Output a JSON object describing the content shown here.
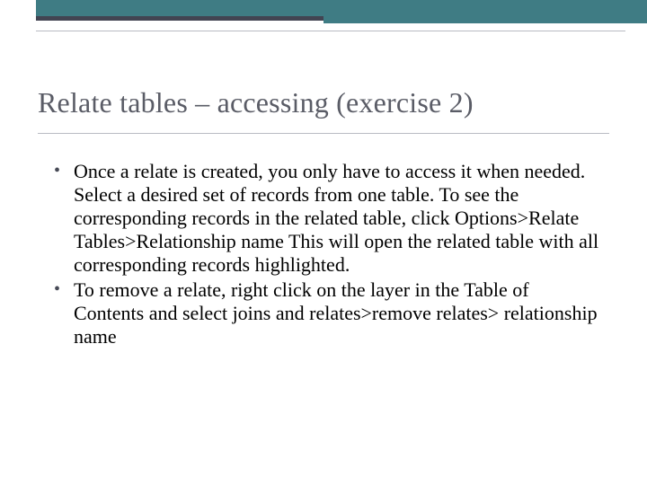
{
  "title": "Relate tables – accessing (exercise 2)",
  "bullets": {
    "b1": "Once a relate is created, you only have to access it when needed.  Select a desired set of records from one table.  To see the corresponding records in the related table, click Options>Relate Tables>Relationship name  This will open the related table with all corresponding records highlighted.",
    "b2": "To remove a relate, right click on the layer in the Table of Contents and select joins and relates>remove relates> relationship name"
  },
  "colors": {
    "teal": "#3f7c84",
    "dark": "#424452",
    "rule": "#b9bbc2",
    "title_text": "#5a5c66"
  }
}
